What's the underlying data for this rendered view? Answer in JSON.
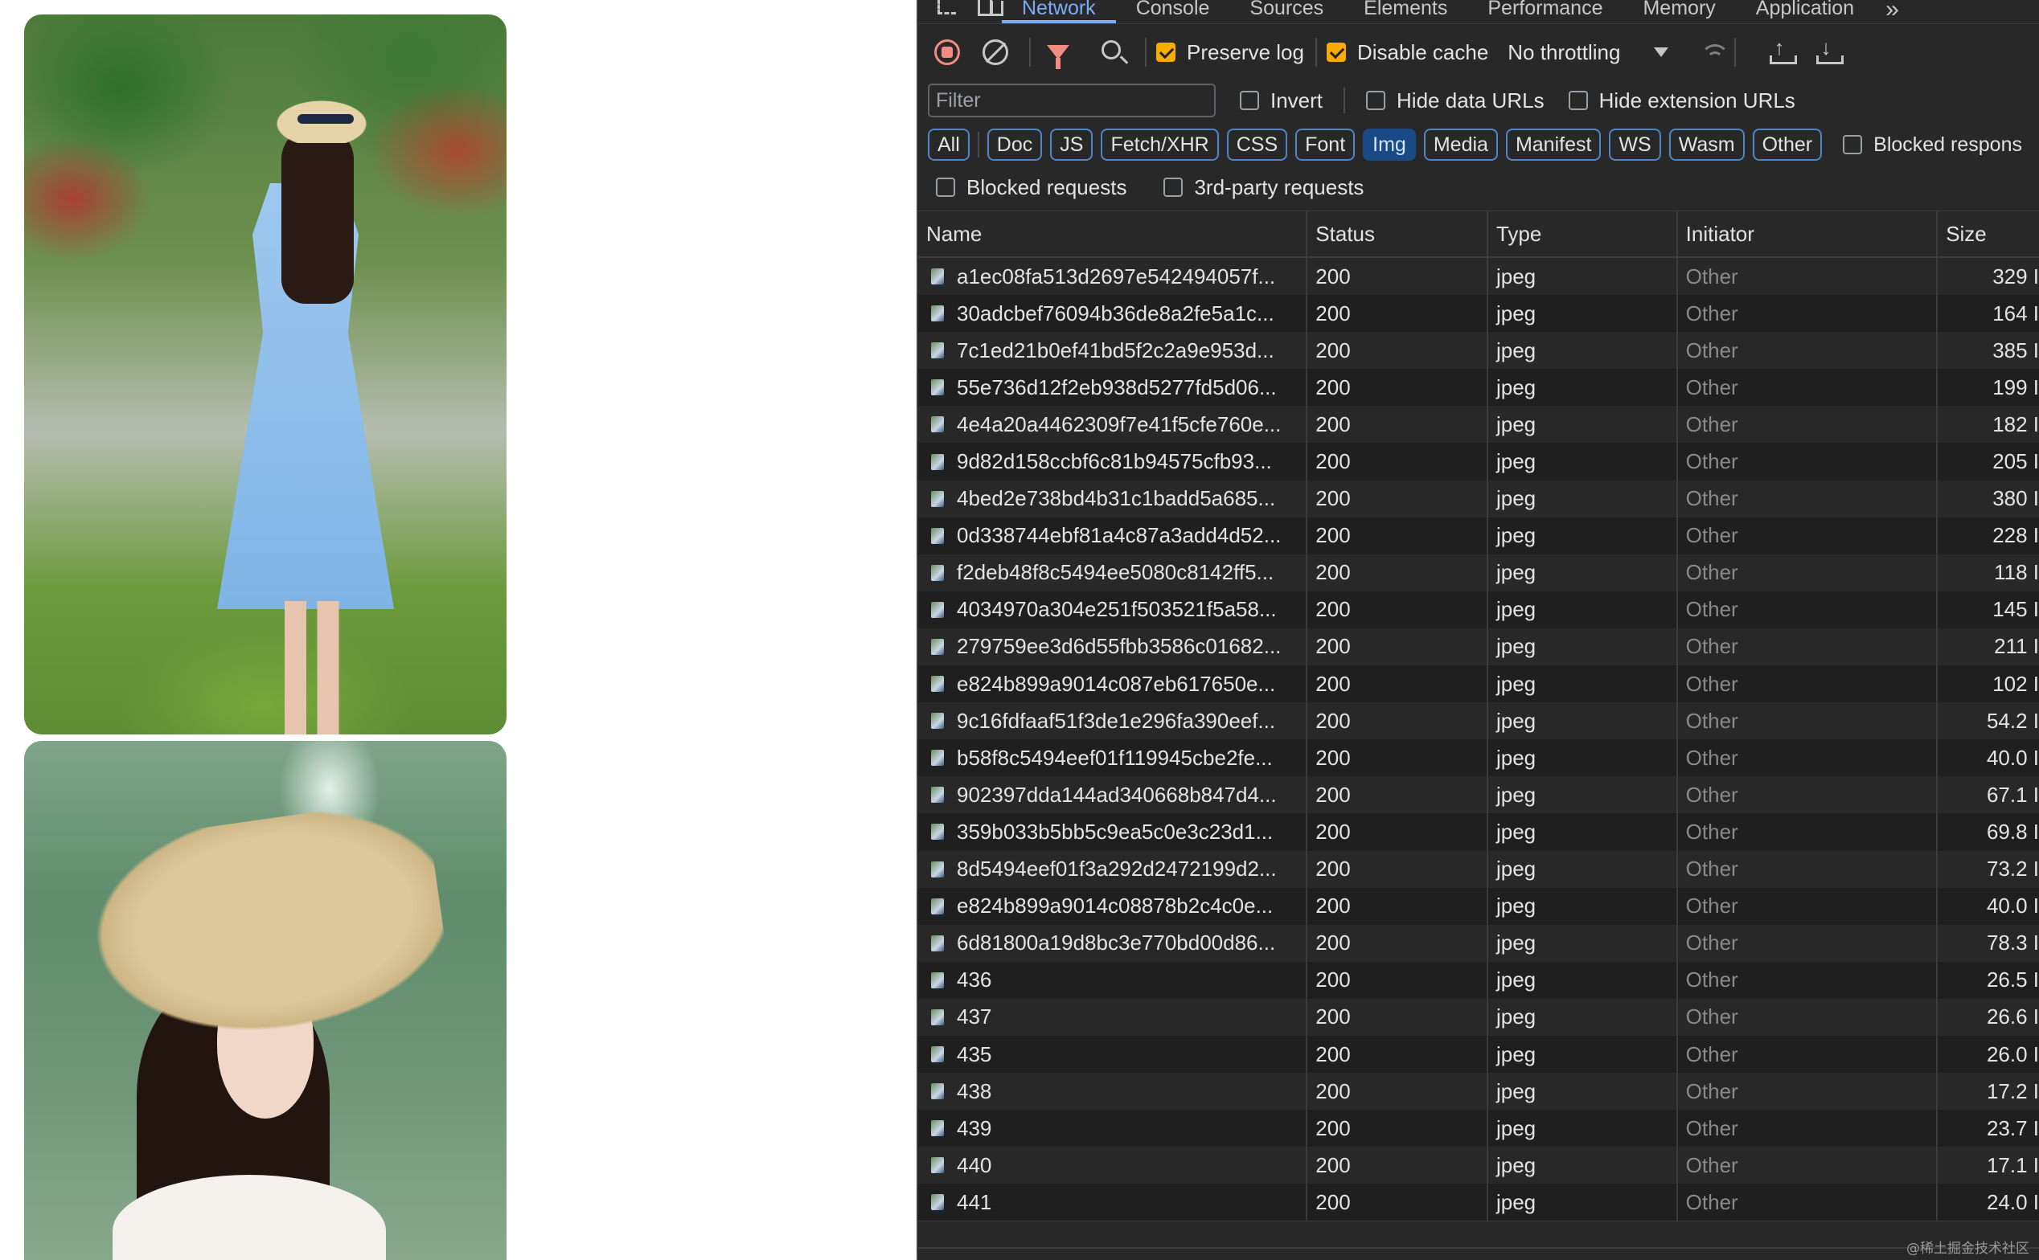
{
  "devtools": {
    "tabs": [
      "Network",
      "Console",
      "Sources",
      "Elements",
      "Performance",
      "Memory",
      "Application"
    ],
    "more_tabs_glyph": "»",
    "toolbar": {
      "preserve_log_label": "Preserve log",
      "preserve_log_checked": true,
      "disable_cache_label": "Disable cache",
      "disable_cache_checked": true,
      "throttling_value": "No throttling"
    },
    "filter": {
      "placeholder": "Filter",
      "invert_label": "Invert",
      "hide_data_urls_label": "Hide data URLs",
      "hide_extension_urls_label": "Hide extension URLs"
    },
    "type_filters": [
      "All",
      "Doc",
      "JS",
      "Fetch/XHR",
      "CSS",
      "Font",
      "Img",
      "Media",
      "Manifest",
      "WS",
      "Wasm",
      "Other"
    ],
    "active_type_filter": "Img",
    "blocked_responses_label": "Blocked respons",
    "blocked_requests_label": "Blocked requests",
    "third_party_label": "3rd-party requests",
    "table": {
      "headers": {
        "name": "Name",
        "status": "Status",
        "type": "Type",
        "initiator": "Initiator",
        "size": "Size"
      },
      "rows": [
        {
          "name": "a1ec08fa513d2697e542494057f...",
          "status": "200",
          "type": "jpeg",
          "initiator": "Other",
          "size": "329 I"
        },
        {
          "name": "30adcbef76094b36de8a2fe5a1c...",
          "status": "200",
          "type": "jpeg",
          "initiator": "Other",
          "size": "164 I"
        },
        {
          "name": "7c1ed21b0ef41bd5f2c2a9e953d...",
          "status": "200",
          "type": "jpeg",
          "initiator": "Other",
          "size": "385 I"
        },
        {
          "name": "55e736d12f2eb938d5277fd5d06...",
          "status": "200",
          "type": "jpeg",
          "initiator": "Other",
          "size": "199 I"
        },
        {
          "name": "4e4a20a4462309f7e41f5cfe760e...",
          "status": "200",
          "type": "jpeg",
          "initiator": "Other",
          "size": "182 I"
        },
        {
          "name": "9d82d158ccbf6c81b94575cfb93...",
          "status": "200",
          "type": "jpeg",
          "initiator": "Other",
          "size": "205 I"
        },
        {
          "name": "4bed2e738bd4b31c1badd5a685...",
          "status": "200",
          "type": "jpeg",
          "initiator": "Other",
          "size": "380 I"
        },
        {
          "name": "0d338744ebf81a4c87a3add4d52...",
          "status": "200",
          "type": "jpeg",
          "initiator": "Other",
          "size": "228 I"
        },
        {
          "name": "f2deb48f8c5494ee5080c8142ff5...",
          "status": "200",
          "type": "jpeg",
          "initiator": "Other",
          "size": "118 I"
        },
        {
          "name": "4034970a304e251f503521f5a58...",
          "status": "200",
          "type": "jpeg",
          "initiator": "Other",
          "size": "145 I"
        },
        {
          "name": "279759ee3d6d55fbb3586c01682...",
          "status": "200",
          "type": "jpeg",
          "initiator": "Other",
          "size": "211 I"
        },
        {
          "name": "e824b899a9014c087eb617650e...",
          "status": "200",
          "type": "jpeg",
          "initiator": "Other",
          "size": "102 I"
        },
        {
          "name": "9c16fdfaaf51f3de1e296fa390eef...",
          "status": "200",
          "type": "jpeg",
          "initiator": "Other",
          "size": "54.2 I"
        },
        {
          "name": "b58f8c5494eef01f119945cbe2fe...",
          "status": "200",
          "type": "jpeg",
          "initiator": "Other",
          "size": "40.0 I"
        },
        {
          "name": "902397dda144ad340668b847d4...",
          "status": "200",
          "type": "jpeg",
          "initiator": "Other",
          "size": "67.1 I"
        },
        {
          "name": "359b033b5bb5c9ea5c0e3c23d1...",
          "status": "200",
          "type": "jpeg",
          "initiator": "Other",
          "size": "69.8 I"
        },
        {
          "name": "8d5494eef01f3a292d2472199d2...",
          "status": "200",
          "type": "jpeg",
          "initiator": "Other",
          "size": "73.2 I"
        },
        {
          "name": "e824b899a9014c08878b2c4c0e...",
          "status": "200",
          "type": "jpeg",
          "initiator": "Other",
          "size": "40.0 I"
        },
        {
          "name": "6d81800a19d8bc3e770bd00d86...",
          "status": "200",
          "type": "jpeg",
          "initiator": "Other",
          "size": "78.3 I"
        },
        {
          "name": "436",
          "status": "200",
          "type": "jpeg",
          "initiator": "Other",
          "size": "26.5 I"
        },
        {
          "name": "437",
          "status": "200",
          "type": "jpeg",
          "initiator": "Other",
          "size": "26.6 I"
        },
        {
          "name": "435",
          "status": "200",
          "type": "jpeg",
          "initiator": "Other",
          "size": "26.0 I"
        },
        {
          "name": "438",
          "status": "200",
          "type": "jpeg",
          "initiator": "Other",
          "size": "17.2 I"
        },
        {
          "name": "439",
          "status": "200",
          "type": "jpeg",
          "initiator": "Other",
          "size": "23.7 I"
        },
        {
          "name": "440",
          "status": "200",
          "type": "jpeg",
          "initiator": "Other",
          "size": "17.1 I"
        },
        {
          "name": "441",
          "status": "200",
          "type": "jpeg",
          "initiator": "Other",
          "size": "24.0 I"
        }
      ]
    },
    "watermark": "@稀土掘金技术社区"
  },
  "colors": {
    "panel_bg": "#282828",
    "accent_blue": "#7cacf8",
    "record_red": "#f28b82",
    "checkbox_orange": "#f9ab00",
    "chip_active_bg": "#1a4a85"
  }
}
